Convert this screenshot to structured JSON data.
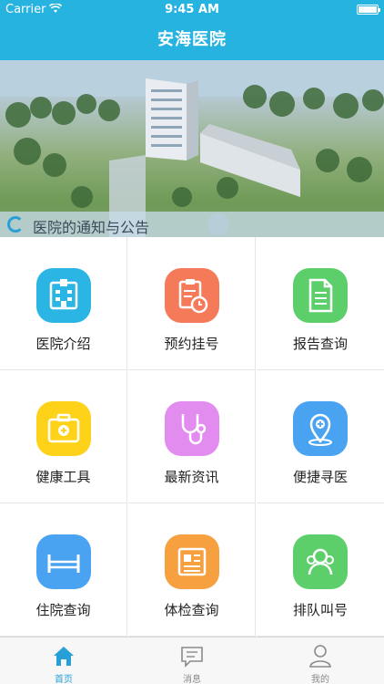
{
  "status_bar": {
    "carrier": "Carrier",
    "time": "9:45 AM"
  },
  "nav": {
    "title": "安海医院"
  },
  "banner": {
    "notice": "医院的通知与公告"
  },
  "grid": [
    {
      "label": "医院介绍",
      "color": "#2bb5e5",
      "icon": "hospital-icon"
    },
    {
      "label": "预约挂号",
      "color": "#f47a5a",
      "icon": "clipboard-clock-icon"
    },
    {
      "label": "报告查询",
      "color": "#5ccf6a",
      "icon": "document-icon"
    },
    {
      "label": "健康工具",
      "color": "#ffd21a",
      "icon": "first-aid-kit-icon"
    },
    {
      "label": "最新资讯",
      "color": "#e38cf0",
      "icon": "stethoscope-icon"
    },
    {
      "label": "便捷寻医",
      "color": "#4aa3f0",
      "icon": "location-pin-icon"
    },
    {
      "label": "住院查询",
      "color": "#4aa3f0",
      "icon": "bed-icon"
    },
    {
      "label": "体检查询",
      "color": "#f6a040",
      "icon": "newspaper-icon"
    },
    {
      "label": "排队叫号",
      "color": "#5ccf6a",
      "icon": "people-icon"
    }
  ],
  "tabbar": [
    {
      "label": "首页",
      "icon": "home-icon",
      "active": true
    },
    {
      "label": "消息",
      "icon": "message-icon",
      "active": false
    },
    {
      "label": "我的",
      "icon": "user-icon",
      "active": false
    }
  ]
}
